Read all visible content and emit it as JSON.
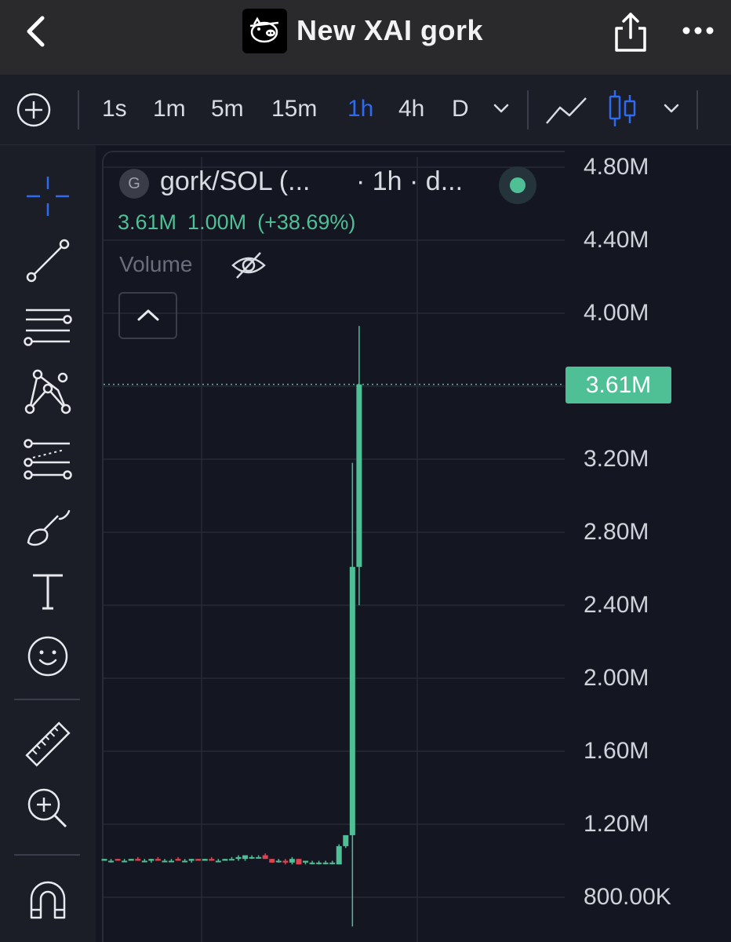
{
  "header": {
    "title": "New XAI gork",
    "logo_icon": "pig-face-logo-icon",
    "back_icon": "chevron-left-icon",
    "share_icon": "share-icon",
    "more_icon": "more-dots-icon"
  },
  "toolbar": {
    "add_icon": "plus-circle-icon",
    "intervals": [
      "1s",
      "1m",
      "5m",
      "15m",
      "1h",
      "4h",
      "D"
    ],
    "active_interval": "1h",
    "chart_type_icons": [
      "line-chart-icon",
      "candlestick-icon"
    ]
  },
  "left_tools": [
    "crosshair-icon",
    "trend-line-icon",
    "horizontal-lines-icon",
    "pattern-icon",
    "fib-icon",
    "brush-icon",
    "text-icon",
    "emoji-icon",
    "ruler-icon",
    "zoom-in-icon",
    "magnet-icon"
  ],
  "legend": {
    "symbol_initial": "G",
    "symbol": "gork/SOL (...",
    "meta": "· 1h · d...",
    "last": "3.61M",
    "change": "1.00M",
    "change_pct": "(+38.69%)",
    "volume_label": "Volume"
  },
  "colors": {
    "up": "#4fbf95",
    "down": "#e0434f",
    "active": "#2f6bf0",
    "background": "#141622"
  },
  "chart_data": {
    "type": "candlestick",
    "y_axis_ticks": [
      "4.80M",
      "4.40M",
      "4.00M",
      "3.60M",
      "3.20M",
      "2.80M",
      "2.40M",
      "2.00M",
      "1.60M",
      "1.20M",
      "800.00K"
    ],
    "y_axis_visible_labels": [
      "4.80M",
      "4.40M",
      "4.00M",
      "3.20M",
      "2.80M",
      "2.40M",
      "2.00M",
      "1.60M",
      "1.20M",
      "800.00K"
    ],
    "ylim": [
      800000,
      4800000
    ],
    "current_price_label": "3.61M",
    "current_price": 3610000,
    "candles": [
      {
        "o": 1000000,
        "h": 1010000,
        "l": 1000000,
        "c": 1010000
      },
      {
        "o": 1000000,
        "h": 1010000,
        "l": 990000,
        "c": 1000000
      },
      {
        "o": 1010000,
        "h": 1010000,
        "l": 1000000,
        "c": 1000000
      },
      {
        "o": 1000000,
        "h": 1010000,
        "l": 1000000,
        "c": 1000000
      },
      {
        "o": 1000000,
        "h": 1010000,
        "l": 1000000,
        "c": 1010000
      },
      {
        "o": 1010000,
        "h": 1020000,
        "l": 1000000,
        "c": 1000000
      },
      {
        "o": 1000000,
        "h": 1010000,
        "l": 1000000,
        "c": 1000000
      },
      {
        "o": 1000000,
        "h": 1010000,
        "l": 990000,
        "c": 1010000
      },
      {
        "o": 1010000,
        "h": 1020000,
        "l": 1010000,
        "c": 1000000
      },
      {
        "o": 1000000,
        "h": 1010000,
        "l": 1000000,
        "c": 1000000
      },
      {
        "o": 1000000,
        "h": 1010000,
        "l": 1000000,
        "c": 1000000
      },
      {
        "o": 1010000,
        "h": 1020000,
        "l": 1000000,
        "c": 1000000
      },
      {
        "o": 1000000,
        "h": 1010000,
        "l": 1000000,
        "c": 1000000
      },
      {
        "o": 1000000,
        "h": 1010000,
        "l": 990000,
        "c": 1010000
      },
      {
        "o": 1010000,
        "h": 1010000,
        "l": 1000000,
        "c": 1000000
      },
      {
        "o": 1000000,
        "h": 1010000,
        "l": 1000000,
        "c": 1010000
      },
      {
        "o": 1010000,
        "h": 1020000,
        "l": 1000000,
        "c": 1000000
      },
      {
        "o": 1000000,
        "h": 1010000,
        "l": 1000000,
        "c": 1000000
      },
      {
        "o": 1000000,
        "h": 1010000,
        "l": 1000000,
        "c": 1010000
      },
      {
        "o": 1010000,
        "h": 1020000,
        "l": 1010000,
        "c": 1010000
      },
      {
        "o": 1010000,
        "h": 1030000,
        "l": 1000000,
        "c": 1020000
      },
      {
        "o": 1010000,
        "h": 1030000,
        "l": 1000000,
        "c": 1030000
      },
      {
        "o": 1020000,
        "h": 1030000,
        "l": 1010000,
        "c": 1020000
      },
      {
        "o": 1020000,
        "h": 1030000,
        "l": 1020000,
        "c": 1020000
      },
      {
        "o": 1030000,
        "h": 1040000,
        "l": 1010000,
        "c": 1010000
      },
      {
        "o": 1010000,
        "h": 1010000,
        "l": 990000,
        "c": 990000
      },
      {
        "o": 1000000,
        "h": 1010000,
        "l": 990000,
        "c": 1000000
      },
      {
        "o": 1000000,
        "h": 1010000,
        "l": 980000,
        "c": 990000
      },
      {
        "o": 990000,
        "h": 1020000,
        "l": 980000,
        "c": 1010000
      },
      {
        "o": 1010000,
        "h": 1010000,
        "l": 980000,
        "c": 980000
      },
      {
        "o": 990000,
        "h": 1000000,
        "l": 980000,
        "c": 1000000
      },
      {
        "o": 990000,
        "h": 1000000,
        "l": 980000,
        "c": 990000
      },
      {
        "o": 990000,
        "h": 1000000,
        "l": 980000,
        "c": 990000
      },
      {
        "o": 990000,
        "h": 1000000,
        "l": 980000,
        "c": 990000
      },
      {
        "o": 990000,
        "h": 1000000,
        "l": 980000,
        "c": 990000
      },
      {
        "o": 980000,
        "h": 1090000,
        "l": 980000,
        "c": 1080000
      },
      {
        "o": 1080000,
        "h": 1140000,
        "l": 1070000,
        "c": 1140000
      },
      {
        "o": 1140000,
        "h": 3180000,
        "l": 640000,
        "c": 2610000
      },
      {
        "o": 2610000,
        "h": 3930000,
        "l": 2400000,
        "c": 3610000
      }
    ]
  }
}
